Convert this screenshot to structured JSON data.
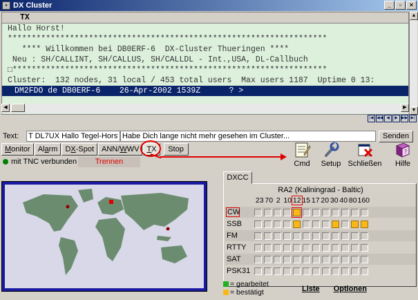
{
  "window": {
    "title": "DX Cluster",
    "btn_min": "_",
    "btn_max": "▫",
    "btn_close": "×"
  },
  "terminal": {
    "header": "TX",
    "lines": [
      "Hallo Horst!",
      "*******************************************************************",
      "   **** Willkommen bei DB0ERF-6  DX-Cluster Thueringen ****",
      " Neu : SH/CALLINT, SH/CALLUS, SH/CALLDL - Int.,USA, DL-Callbuch",
      "□******************************************************************",
      "Cluster:  132 nodes, 31 local / 453 total users  Max users 1187  Uptime 0 13:"
    ],
    "selected_line": "DM2FDO de DB0ERF-6    26-Apr-2002 1539Z      ? >"
  },
  "nav": [
    "|◀",
    "◀◀",
    "◀",
    "▶",
    "▶▶",
    "▶|"
  ],
  "textbar": {
    "label": "Text:",
    "field1": "T DL7UX Hallo Tegel-Horst!",
    "field2": "Habe Dich lange nicht mehr gesehen im Cluster...",
    "send": "Senden"
  },
  "tabs": {
    "monitor_pre": "",
    "monitor_u": "M",
    "monitor_post": "onitor",
    "alarm_pre": "Al",
    "alarm_u": "a",
    "alarm_post": "rm",
    "dxspot_pre": "D",
    "dxspot_u": "X",
    "dxspot_post": "-Spot",
    "annwwv_pre": "ANN/",
    "annwwv_u": "W",
    "annwwv_post": "WV",
    "tx_pre": "",
    "tx_u": "T",
    "tx_post": "X",
    "stop": "Stop"
  },
  "status": {
    "tnc": "mit TNC verbunden",
    "disconnect": "Trennen"
  },
  "toolbar": {
    "cmd": "Cmd",
    "setup": "Setup",
    "close": "Schließen",
    "help": "Hilfe"
  },
  "dxcc": {
    "tab": "DXCC",
    "title": "RA2  (Kaliningrad - Baltic)",
    "bands": [
      "23",
      "70",
      "2",
      "10",
      "12",
      "15",
      "17",
      "20",
      "30",
      "40",
      "80",
      "160"
    ],
    "modes": [
      {
        "name": "CW",
        "cells": [
          "n",
          "n",
          "n",
          "n",
          "c",
          "n",
          "n",
          "n",
          "n",
          "n",
          "n",
          "n"
        ]
      },
      {
        "name": "SSB",
        "cells": [
          "n",
          "n",
          "n",
          "n",
          "c",
          "n",
          "n",
          "n",
          "c",
          "n",
          "c",
          "c"
        ]
      },
      {
        "name": "FM",
        "cells": [
          "n",
          "n",
          "n",
          "n",
          "n",
          "n",
          "n",
          "n",
          "n",
          "n",
          "n",
          "n"
        ]
      },
      {
        "name": "RTTY",
        "cells": [
          "n",
          "n",
          "n",
          "n",
          "n",
          "n",
          "n",
          "n",
          "n",
          "n",
          "n",
          "n"
        ]
      },
      {
        "name": "SAT",
        "cells": [
          "n",
          "n",
          "n",
          "n",
          "n",
          "n",
          "n",
          "n",
          "n",
          "n",
          "n",
          "n"
        ]
      },
      {
        "name": "PSK31",
        "cells": [
          "n",
          "n",
          "n",
          "n",
          "n",
          "n",
          "n",
          "n",
          "n",
          "n",
          "n",
          "n"
        ]
      }
    ],
    "legend_worked": "= gearbeitet",
    "legend_confirmed": "= bestätigt",
    "list": "Liste",
    "options": "Optionen"
  },
  "colors": {
    "worked": "#20b020",
    "confirmed": "#f8b818",
    "accent": "#e00000",
    "titlebar": "#0a246a"
  }
}
